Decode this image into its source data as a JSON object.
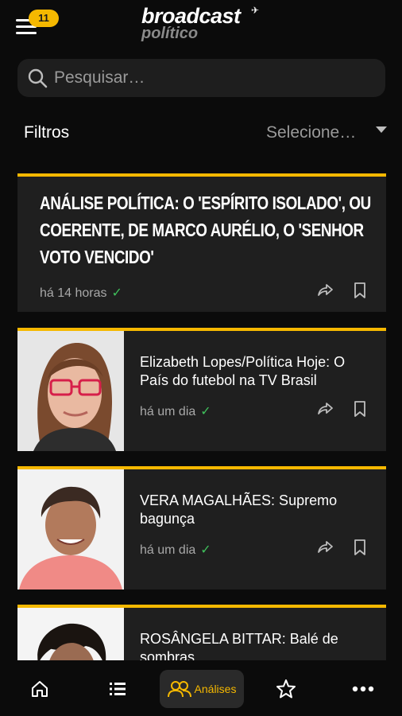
{
  "header": {
    "notification_count": "11",
    "logo_primary": "broadcast",
    "logo_secondary": "político"
  },
  "search": {
    "placeholder": "Pesquisar…"
  },
  "filters": {
    "label": "Filtros",
    "select_value": "Selecione…"
  },
  "feed": [
    {
      "title": "ANÁLISE POLÍTICA: O 'ESPÍRITO ISOLADO', OU COERENTE, DE MARCO AURÉLIO, O 'SENHOR VOTO VENCIDO'",
      "time": "há 14 horas",
      "read": true
    },
    {
      "title": "Elizabeth Lopes/Política Hoje: O País do futebol na TV Brasil",
      "time": "há um dia",
      "read": true
    },
    {
      "title": "VERA MAGALHÃES: Supremo bagunça",
      "time": "há um dia",
      "read": true
    },
    {
      "title": "ROSÂNGELA BITTAR: Balé de sombras",
      "time": "",
      "read": false
    }
  ],
  "bottom_nav": {
    "items": [
      {
        "icon": "home-icon"
      },
      {
        "icon": "list-icon"
      },
      {
        "icon": "users-icon",
        "label": "Análises",
        "active": true
      },
      {
        "icon": "star-icon"
      },
      {
        "icon": "more-icon"
      }
    ]
  },
  "colors": {
    "accent": "#f5b800",
    "card": "#1f1f1f",
    "background": "#0b0b0b",
    "check": "#3fbf5b"
  }
}
